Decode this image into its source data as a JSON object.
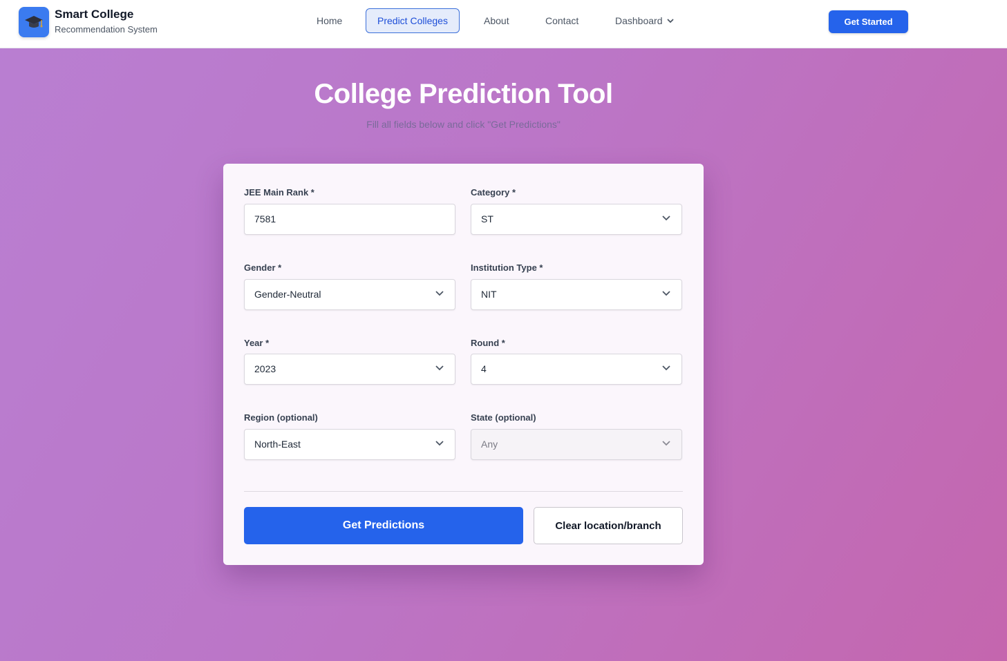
{
  "navbar": {
    "brand_title": "Smart College",
    "brand_subtitle": "Recommendation System",
    "items": [
      {
        "label": "Home"
      },
      {
        "label": "Predict Colleges"
      },
      {
        "label": "About"
      },
      {
        "label": "Contact"
      },
      {
        "label": "Dashboard"
      }
    ],
    "cta_label": "Get Started"
  },
  "hero": {
    "title": "College Prediction Tool",
    "subtitle": "Fill all fields below and click \"Get Predictions\""
  },
  "form": {
    "rank": {
      "label": "JEE Main Rank *",
      "value": "7581"
    },
    "category": {
      "label": "Category *",
      "value": "ST"
    },
    "gender": {
      "label": "Gender *",
      "value": "Gender-Neutral"
    },
    "institution_type": {
      "label": "Institution Type *",
      "value": "NIT"
    },
    "year": {
      "label": "Year *",
      "value": "2023"
    },
    "round": {
      "label": "Round *",
      "value": "4"
    },
    "region": {
      "label": "Region (optional)",
      "value": "North-East"
    },
    "state": {
      "label": "State (optional)",
      "value": "Any"
    },
    "predict_label": "Get Predictions",
    "clear_label": "Clear location/branch"
  },
  "colors": {
    "accent": "#2563eb",
    "background_start": "#b97fd2",
    "background_end": "#c466ae"
  },
  "icons": {
    "logo": "graduation-cap-icon",
    "dropdown": "chevron-down-icon"
  }
}
